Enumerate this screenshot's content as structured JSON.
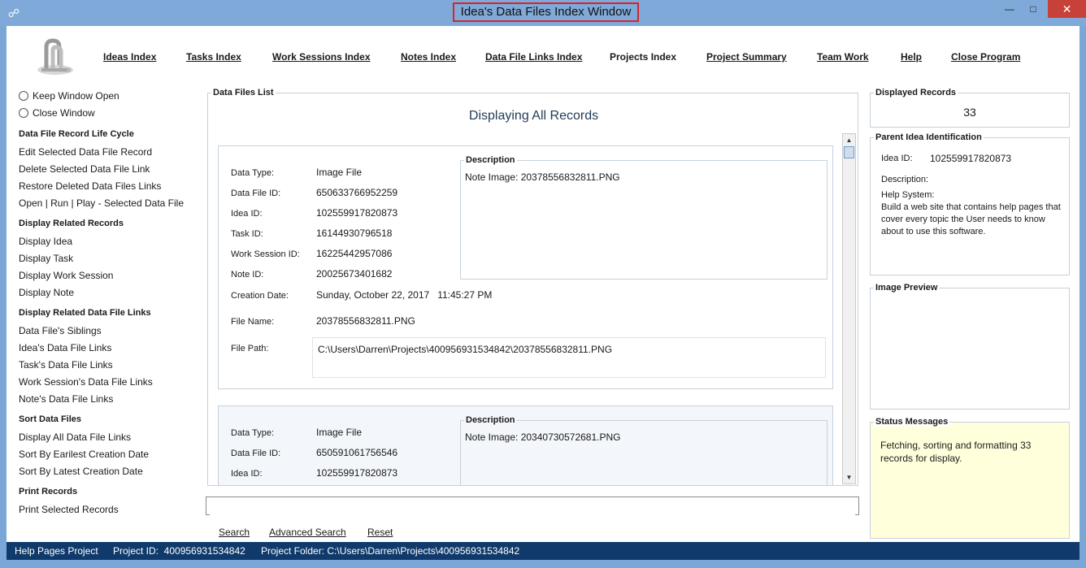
{
  "window": {
    "title": "Idea's Data Files Index Window",
    "minimize": "—",
    "maximize": "□",
    "close": "✕"
  },
  "nav": [
    "Ideas Index",
    "Tasks Index",
    "Work Sessions Index",
    "Notes Index",
    "Data File Links Index",
    "Projects Index",
    "Project Summary",
    "Team Work",
    "Help",
    "Close Program"
  ],
  "left": {
    "keep_open": "Keep Window Open",
    "close_window": "Close Window",
    "sections": [
      {
        "header": "Data File Record Life Cycle",
        "items": [
          "Edit Selected Data File Record",
          "Delete Selected Data File Link",
          "Restore Deleted Data Files Links",
          "Open | Run | Play - Selected Data File"
        ]
      },
      {
        "header": "Display Related Records",
        "items": [
          "Display Idea",
          "Display Task",
          "Display Work Session",
          "Display Note"
        ]
      },
      {
        "header": "Display Related Data File Links",
        "items": [
          "Data File's Siblings",
          "Idea's Data File Links",
          "Task's Data File Links",
          "Work Session's Data File Links",
          "Note's Data File Links"
        ]
      },
      {
        "header": "Sort Data Files",
        "items": [
          "Display All Data File Links",
          "Sort By Earilest Creation Date",
          "Sort By Latest Creation Date"
        ]
      },
      {
        "header": "Print Records",
        "items": [
          "Print Selected Records"
        ]
      }
    ]
  },
  "main": {
    "legend": "Data Files List",
    "heading": "Displaying All Records",
    "labels": {
      "data_type": "Data Type:",
      "data_file_id": "Data File ID:",
      "idea_id": "Idea ID:",
      "task_id": "Task ID:",
      "work_session_id": "Work Session ID:",
      "note_id": "Note ID:",
      "creation_date": "Creation Date:",
      "file_name": "File Name:",
      "file_path": "File Path:",
      "description": "Description"
    },
    "records": [
      {
        "data_type": "Image File",
        "data_file_id": "650633766952259",
        "idea_id": "102559917820873",
        "task_id": "16144930796518",
        "work_session_id": "16225442957086",
        "note_id": "20025673401682",
        "creation_date": "Sunday, October 22, 2017   11:45:27 PM",
        "file_name": "20378556832811.PNG",
        "file_path": "C:\\Users\\Darren\\Projects\\400956931534842\\20378556832811.PNG",
        "description": "Note Image: 20378556832811.PNG"
      },
      {
        "data_type": "Image File",
        "data_file_id": "650591061756546",
        "idea_id": "102559917820873",
        "description": "Note Image: 20340730572681.PNG"
      }
    ]
  },
  "search": {
    "value": "",
    "search": "Search",
    "advanced": "Advanced Search",
    "reset": "Reset"
  },
  "right": {
    "displayed_legend": "Displayed Records",
    "displayed_count": "33",
    "parent_legend": "Parent Idea Identification",
    "idea_id_label": "Idea ID:",
    "idea_id": "102559917820873",
    "description_label": "Description:",
    "description_line1": "Help System:",
    "description_line2": "Build a web site that contains help pages that",
    "description_line3": "cover every topic the User needs to know",
    "description_line4": "about to use this software.",
    "image_legend": "Image Preview",
    "status_legend": "Status Messages",
    "status_line1": "Fetching, sorting and formatting 33",
    "status_line2": "records for display."
  },
  "statusbar": {
    "project": "Help Pages Project",
    "project_id": "Project ID:  400956931534842",
    "project_folder": "Project Folder: C:\\Users\\Darren\\Projects\\400956931534842"
  },
  "colors": {
    "titlebar": "#7fa9d8",
    "statusbar": "#0f3a6b",
    "close": "#c7413a",
    "status_bg": "#ffffdc",
    "title_border": "#d9232d"
  }
}
